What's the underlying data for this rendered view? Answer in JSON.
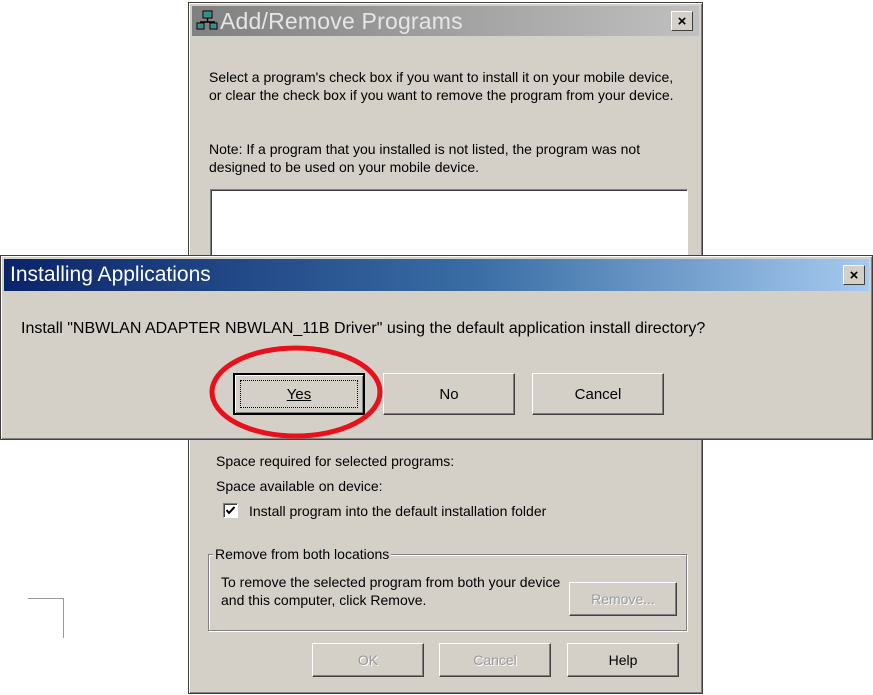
{
  "main_dialog": {
    "title": "Add/Remove Programs",
    "close_glyph": "×",
    "intro_text": "Select a program's check box if you want to install it on your mobile device, or clear the check box if you want to remove the program from your device.",
    "note_text": "Note:  If a program that you installed is not listed, the program was not designed to be used on your mobile device.",
    "space_required_label": "Space required for selected programs:",
    "space_available_label": "Space available on device:",
    "install_default_checkbox": {
      "checked": true,
      "label": "Install program into the default installation folder"
    },
    "remove_group": {
      "title": "Remove from both locations",
      "text": "To remove the selected program from both your device and this computer, click Remove.",
      "remove_button": "Remove..."
    },
    "buttons": {
      "ok": "OK",
      "cancel": "Cancel",
      "help": "Help"
    }
  },
  "install_dialog": {
    "title": "Installing Applications",
    "close_glyph": "×",
    "question": "Install \"NBWLAN ADAPTER NBWLAN_11B Driver\" using the default application install directory?",
    "buttons": {
      "yes": "Yes",
      "no": "No",
      "cancel": "Cancel"
    }
  },
  "colors": {
    "title_gradient_start": "#0a246a",
    "title_gradient_end": "#a6caf0",
    "face": "#d4d0c8",
    "highlight_ring": "#e8101a"
  },
  "icons": {
    "app_icon": "network-computer-icon",
    "check": "checkmark-icon"
  }
}
